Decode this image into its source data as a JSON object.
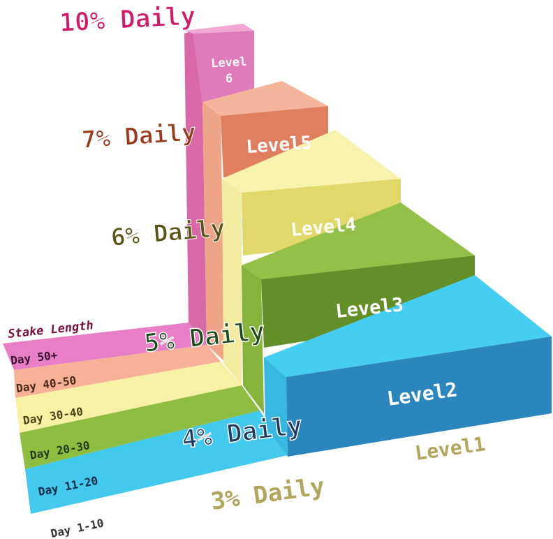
{
  "stake_header": "Stake Length",
  "stake_rows": [
    {
      "label": "Day 50+",
      "color": "#e87fc6"
    },
    {
      "label": "Day 40-50",
      "color": "#f4a98c"
    },
    {
      "label": "Day 30-40",
      "color": "#f6ef9e"
    },
    {
      "label": "Day 20-30",
      "color": "#8ab83c"
    },
    {
      "label": "Day 11-20",
      "color": "#3ec7ec"
    },
    {
      "label": "Day 1-10",
      "color": "#ffffff"
    }
  ],
  "levels": [
    {
      "label": "Level1",
      "rate": "3% Daily",
      "rate_color": "#b0a65c"
    },
    {
      "label": "Level2",
      "rate": "4% Daily",
      "rate_color": "#1c3a66",
      "color": "#2a86bd"
    },
    {
      "label": "Level3",
      "rate": "5% Daily",
      "rate_color": "#1e4a18",
      "color": "#5f8a27"
    },
    {
      "label": "Level4",
      "rate": "6% Daily",
      "rate_color": "#5a5418",
      "color": "#e2d76a"
    },
    {
      "label": "Level5",
      "rate": "7% Daily",
      "rate_color": "#9a3a18",
      "color": "#e07d5c"
    },
    {
      "label": "Level 6",
      "rate": "10% Daily",
      "rate_color": "#d11a6a",
      "color": "#dc72b2"
    }
  ]
}
